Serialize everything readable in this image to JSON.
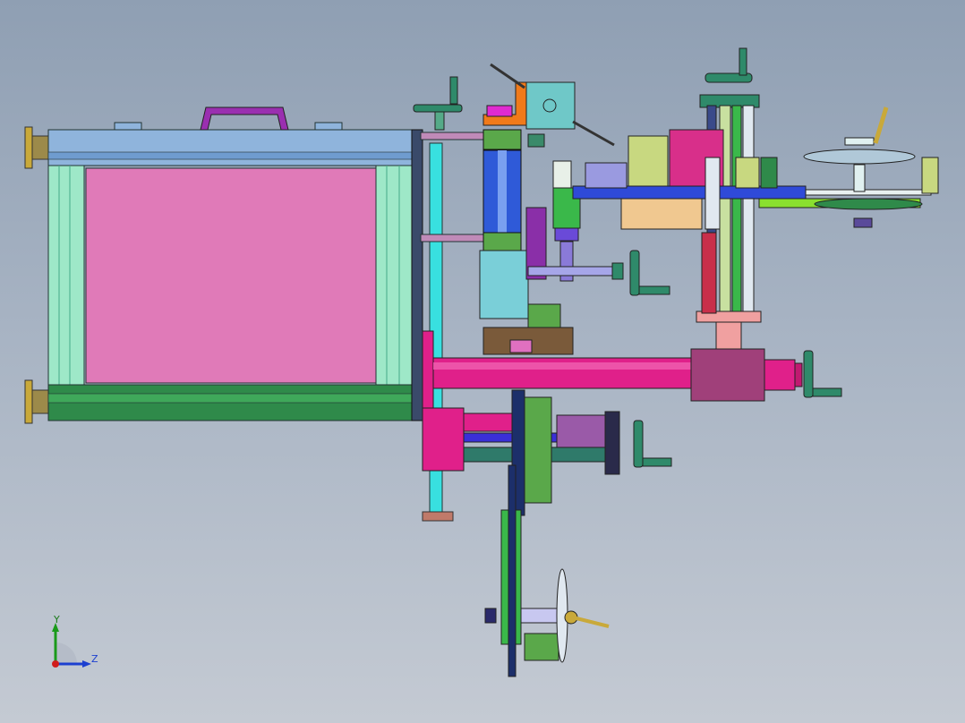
{
  "viewport": {
    "background_top": "#8f9fb3",
    "background_bottom": "#c4cad3"
  },
  "triad": {
    "y_label": "Y",
    "z_label": "Z",
    "y_color": "#1a7a1a",
    "z_color": "#1c3fd0",
    "x_color": "#d01c1c"
  },
  "colors": {
    "frame_blue": "#8fb4dc",
    "frame_cyan": "#9ee8c8",
    "panel_pink": "#e07ab8",
    "frame_green": "#2f8a4a",
    "handle_purple": "#9a2fb0",
    "roller_magenta": "#e0208a",
    "roller_body": "#a0407a",
    "motor_pink": "#d82f8a",
    "dark_navy": "#1c2f6a"
  }
}
